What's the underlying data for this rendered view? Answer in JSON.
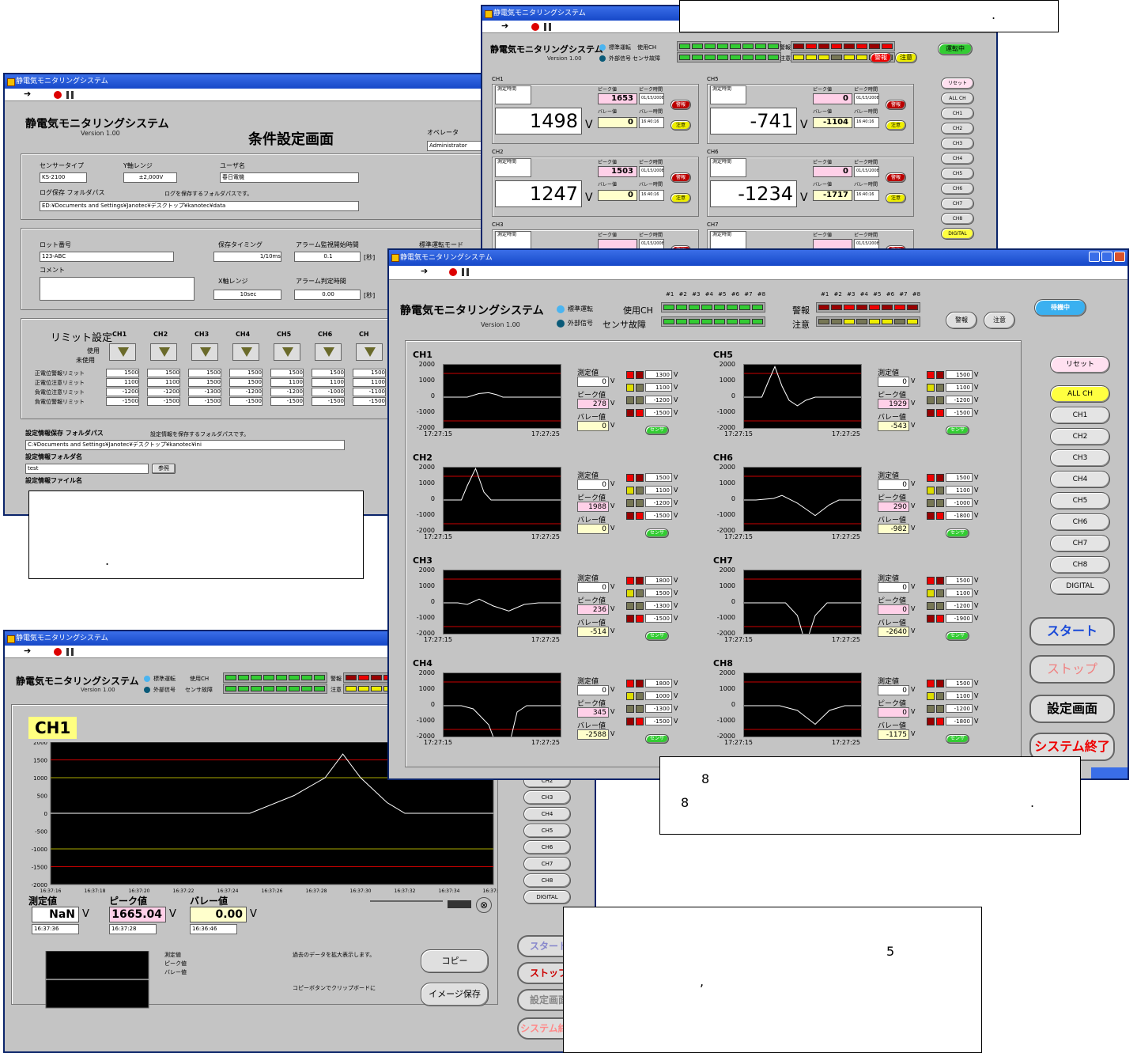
{
  "w1": {
    "title": "静電気モニタリングシステム",
    "app": "静電気モニタリングシステム",
    "version": "Version 1.00",
    "screen": "条件設定画面",
    "op_label": "オペレータ",
    "op_value": "Administrator",
    "sensor_label": "センサータイプ",
    "sensor_value": "KS-2100",
    "range_label": "Y軸レンジ",
    "range_value": "±2,000V",
    "user_label": "ユーザ名",
    "user_value": "春日電機",
    "logdir_label": "ログ保存 フォルダパス",
    "logdir_hint": "ログを保存するフォルダパスです。",
    "logdir_value": "ED:¥Documents and Settings¥Janotec¥デスクトップ¥kanotec¥data",
    "lot_label": "ロット番号",
    "lot_value": "123-ABC",
    "comment_label": "コメント",
    "save_timing_label": "保存タイミング",
    "save_timing_value": "1/10ms",
    "alarm_start_label": "アラーム監視開始時間",
    "alarm_start_value": "0.1",
    "sec": "[秒]",
    "std_label": "標準運転モード",
    "xrange_label": "X軸レンジ",
    "xrange_value": "10sec",
    "alarm_judge_label": "アラーム判定時間",
    "alarm_judge_value": "0.00",
    "limit_label": "リミット設定",
    "use": "使用",
    "unuse": "未使用",
    "channels": [
      "CH1",
      "CH2",
      "CH3",
      "CH4",
      "CH5",
      "CH6",
      "CH"
    ],
    "rows": [
      "正電位警報リミット",
      "正電位注意リミット",
      "負電位注意リミット",
      "負電位警報リミット"
    ],
    "limit_values": [
      [
        "1500",
        "1500",
        "1500",
        "1500",
        "1500",
        "1500",
        "1500"
      ],
      [
        "1100",
        "1100",
        "1500",
        "1500",
        "1100",
        "1100",
        "1100"
      ],
      [
        "-1200",
        "-1200",
        "-1300",
        "-1200",
        "-1200",
        "-1000",
        "-1100"
      ],
      [
        "-1500",
        "-1500",
        "-1500",
        "-1500",
        "-1500",
        "-1500",
        "-1500"
      ]
    ],
    "cfg_label": "設定情報保存 フォルダパス",
    "cfg_hint": "設定情報を保存するフォルダパスです。",
    "cfg_value": "C:¥Documents and Settings¥Janotec¥デスクトップ¥kanotec¥ini",
    "cfg_name_label": "設定情報フォルダ名",
    "cfg_name_value": "test",
    "browse": "参照",
    "cfg_file_label": "設定情報ファイル名"
  },
  "w2": {
    "title": "静電気モニタリングシステム",
    "app": "静電気モニタリングシステム",
    "version": "Version 1.00",
    "std": "標準運転",
    "ext": "外部信号",
    "use_ch": "使用CH",
    "sensor_fail": "センサ故障",
    "alarm": "警報",
    "caution": "注意",
    "state": "運転中",
    "measure_time": "測定時間",
    "peak": "ピーク値",
    "peak_time": "ピーク時間",
    "valley": "バレー値",
    "valley_time": "バレー時間",
    "date": "01/15/2008",
    "time": "16:40:16",
    "v": "V",
    "cards": [
      {
        "ch": "CH1",
        "value": "1498",
        "peak": "1653",
        "valley": "0"
      },
      {
        "ch": "CH5",
        "value": "-741",
        "peak": "0",
        "valley": "-1104"
      },
      {
        "ch": "CH2",
        "value": "1247",
        "peak": "1503",
        "valley": "0"
      },
      {
        "ch": "CH6",
        "value": "-1234",
        "peak": "0",
        "valley": "-1717"
      },
      {
        "ch": "CH3",
        "value": "",
        "peak": "",
        "valley": ""
      },
      {
        "ch": "CH7",
        "value": "",
        "peak": "",
        "valley": ""
      }
    ],
    "side": [
      "リセット",
      "ALL CH",
      "CH1",
      "CH2",
      "CH3",
      "CH4",
      "CH5",
      "CH6",
      "CH7",
      "CH8",
      "DIGITAL"
    ]
  },
  "w3": {
    "title": "静電気モニタリングシステム",
    "app": "静電気モニタリングシステム",
    "version": "Version 1.00",
    "std": "標準運転",
    "ext": "外部信号",
    "use_ch": "使用CH",
    "sensor_fail": "センサ故障",
    "alarm": "警報",
    "caution": "注意",
    "state": "待機中",
    "alarm_btn": "警報",
    "caution_btn": "注意",
    "lamp_nums": "#1 #2 #3 #4 #5 #6 #7 #8",
    "meas": "測定値",
    "peak": "ピーク値",
    "valley": "バレー値",
    "sensor": "センサ",
    "v": "V",
    "t0": "17:27:15",
    "t1": "17:27:25",
    "yticks": [
      "2000",
      "1000",
      "0",
      "-1000",
      "-2000"
    ],
    "channels": [
      {
        "name": "CH1",
        "meas": "0",
        "peak": "278",
        "valley": "0",
        "lim": [
          "1300",
          "1100",
          "-1200",
          "-1500"
        ]
      },
      {
        "name": "CH5",
        "meas": "0",
        "peak": "1929",
        "valley": "-543",
        "lim": [
          "1500",
          "1100",
          "-1200",
          "-1500"
        ]
      },
      {
        "name": "CH2",
        "meas": "0",
        "peak": "1988",
        "valley": "0",
        "lim": [
          "1500",
          "1100",
          "-1200",
          "-1500"
        ]
      },
      {
        "name": "CH6",
        "meas": "0",
        "peak": "290",
        "valley": "-982",
        "lim": [
          "1500",
          "1100",
          "-1000",
          "-1800"
        ]
      },
      {
        "name": "CH3",
        "meas": "0",
        "peak": "236",
        "valley": "-514",
        "lim": [
          "1800",
          "1500",
          "-1300",
          "-1500"
        ]
      },
      {
        "name": "CH7",
        "meas": "0",
        "peak": "0",
        "valley": "-2640",
        "lim": [
          "1500",
          "1100",
          "-1200",
          "-1900"
        ]
      },
      {
        "name": "CH4",
        "meas": "0",
        "peak": "345",
        "valley": "-2588",
        "lim": [
          "1800",
          "1000",
          "-1300",
          "-1500"
        ]
      },
      {
        "name": "CH8",
        "meas": "0",
        "peak": "0",
        "valley": "-1175",
        "lim": [
          "1500",
          "1100",
          "-1200",
          "-1800"
        ]
      }
    ],
    "side": [
      "リセット",
      "ALL CH",
      "CH1",
      "CH2",
      "CH3",
      "CH4",
      "CH5",
      "CH6",
      "CH7",
      "CH8",
      "DIGITAL"
    ],
    "start": "スタート",
    "stop": "ストップ",
    "settings": "設定画面",
    "exit": "システム終了"
  },
  "w4": {
    "title": "静電気モニタリングシステム",
    "app": "静電気モニタリングシステム",
    "version": "Version 1.00",
    "std": "標準運転",
    "ext": "外部信号",
    "use_ch": "使用CH",
    "sensor_fail": "センサ故障",
    "alarm": "警報",
    "caution": "注意",
    "ch": "CH1",
    "yticks": [
      "2000",
      "1500",
      "1000",
      "500",
      "0",
      "-500",
      "-1000",
      "-1500",
      "-2000"
    ],
    "xticks": [
      "16:37:16",
      "16:37:18",
      "16:37:20",
      "16:37:22",
      "16:37:24",
      "16:37:26",
      "16:37:28",
      "16:37:30",
      "16:37:32",
      "16:37:34",
      "16:37:36"
    ],
    "meas": "測定値",
    "peak": "ピーク値",
    "valley": "バレー値",
    "meas_v": "NaN",
    "peak_v": "1665.04",
    "valley_v": "0.00",
    "v": "V",
    "meas_t": "16:37:36",
    "peak_t": "16:37:28",
    "valley_t": "16:36:46",
    "copy_note": "過去のデータを拡大表示します。",
    "img_note": "コピーボタンでクリップボードに",
    "copy": "コピー",
    "save_img": "イメージ保存",
    "side": [
      "CH2",
      "CH3",
      "CH4",
      "CH5",
      "CH6",
      "CH7",
      "CH8",
      "DIGITAL"
    ],
    "start": "スタート",
    "stop": "ストップ",
    "settings": "設定画面",
    "exit": "システム終了"
  },
  "notes": {
    "n1": ".",
    "n2a": "8",
    "n2b": "8",
    "n2c": ".",
    "n3a": "5",
    "n3b": ",",
    "n4": "."
  }
}
